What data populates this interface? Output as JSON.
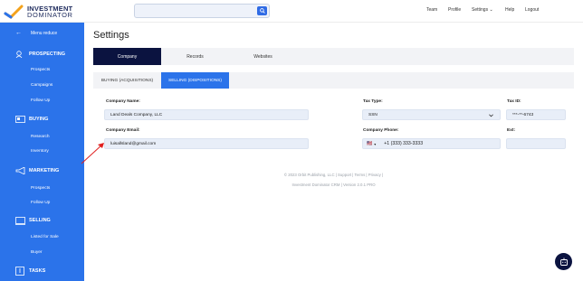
{
  "brand": {
    "line1": "INVESTMENT",
    "line2": "DOMINATOR"
  },
  "search": {
    "placeholder": ""
  },
  "topnav": [
    "Team",
    "Profile",
    "Settings ⌄",
    "Help",
    "Logout"
  ],
  "sidebar": {
    "menu_reduce": "Menu reduce",
    "sections": [
      {
        "label": "PROSPECTING",
        "icon": "search-people-icon",
        "items": [
          "Prospects",
          "Campaigns",
          "Follow Up"
        ]
      },
      {
        "label": "BUYING",
        "icon": "buying-icon",
        "items": [
          "Research",
          "Inventory"
        ]
      },
      {
        "label": "MARKETING",
        "icon": "megaphone-icon",
        "items": [
          "Prospects",
          "Follow Up"
        ]
      },
      {
        "label": "SELLING",
        "icon": "selling-icon",
        "items": [
          "Listed for Sale",
          "Buyer"
        ]
      },
      {
        "label": "TASKS",
        "icon": "tasks-icon",
        "items": []
      }
    ]
  },
  "page": {
    "title": "Settings"
  },
  "tabs": [
    "Company",
    "Records",
    "Websites"
  ],
  "subtabs": [
    "BUYING (ACQUISITIONS)",
    "SELLING (DISPOSITIONS)"
  ],
  "form": {
    "company_name_label": "Company Name:",
    "company_name_value": "Land Deals Company, LLC",
    "tax_type_label": "Tax Type:",
    "tax_type_value": "SSN",
    "tax_id_label": "Tax ID:",
    "tax_id_value": "***-**-6743",
    "company_email_label": "Company Email:",
    "company_email_value": "luisallsland@gmail.com",
    "company_phone_label": "Company Phone:",
    "company_phone_value": "+1 (333) 333-3333",
    "phone_country_flag": "🇺🇸",
    "ext_label": "Ext:",
    "ext_value": ""
  },
  "footer": {
    "line1": "© 2023 Orbit Publishing, LLC  |  Support  |  Terms  |  Privacy  |",
    "line2": "Investment Dominator CRM  |  Version 2.0.1 PRO"
  },
  "colors": {
    "sidebar": "#2b73ea",
    "navy": "#0b1340",
    "accent": "#2b73ea",
    "arrow": "#e02020"
  }
}
